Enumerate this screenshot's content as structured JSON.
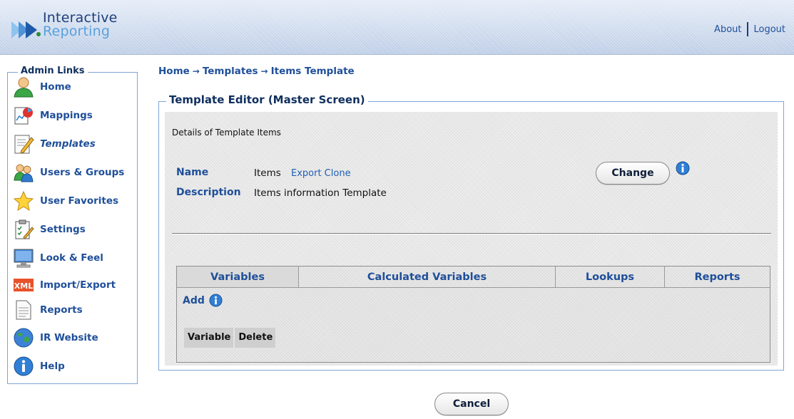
{
  "header": {
    "logo_line1": "Interactive",
    "logo_line2": "Reporting",
    "about_label": "About",
    "logout_label": "Logout"
  },
  "sidebar": {
    "title": "Admin Links",
    "items": [
      {
        "label": "Home",
        "icon": "home-user-icon"
      },
      {
        "label": "Mappings",
        "icon": "mappings-icon"
      },
      {
        "label": "Templates",
        "icon": "templates-icon",
        "active": true
      },
      {
        "label": "Users & Groups",
        "icon": "users-groups-icon"
      },
      {
        "label": "User Favorites",
        "icon": "star-icon"
      },
      {
        "label": "Settings",
        "icon": "settings-clipboard-icon"
      },
      {
        "label": "Look & Feel",
        "icon": "monitor-icon"
      },
      {
        "label": "Import/Export",
        "icon": "xml-icon"
      },
      {
        "label": "Reports",
        "icon": "report-document-icon"
      },
      {
        "label": "IR Website",
        "icon": "globe-icon"
      },
      {
        "label": "Help",
        "icon": "info-icon"
      }
    ]
  },
  "breadcrumb": {
    "home": "Home",
    "templates": "Templates",
    "current": "Items Template",
    "separator": "→"
  },
  "editor": {
    "title": "Template Editor (Master Screen)",
    "details_text": "Details of Template Items",
    "name_label": "Name",
    "name_value": "Items",
    "export_clone_label": "Export Clone",
    "description_label": "Description",
    "description_value": "Items information Template",
    "change_button": "Change"
  },
  "tabs": [
    {
      "label": "Variables",
      "active": true
    },
    {
      "label": "Calculated Variables",
      "active": false
    },
    {
      "label": "Lookups",
      "active": false
    },
    {
      "label": "Reports",
      "active": false
    }
  ],
  "variables_panel": {
    "add_label": "Add",
    "columns": [
      "Variable",
      "Delete"
    ]
  },
  "footer": {
    "cancel_button": "Cancel"
  },
  "colors": {
    "link_blue": "#1f4f9a",
    "border_blue": "#7ea6d8",
    "title_navy": "#0f2f5e"
  }
}
